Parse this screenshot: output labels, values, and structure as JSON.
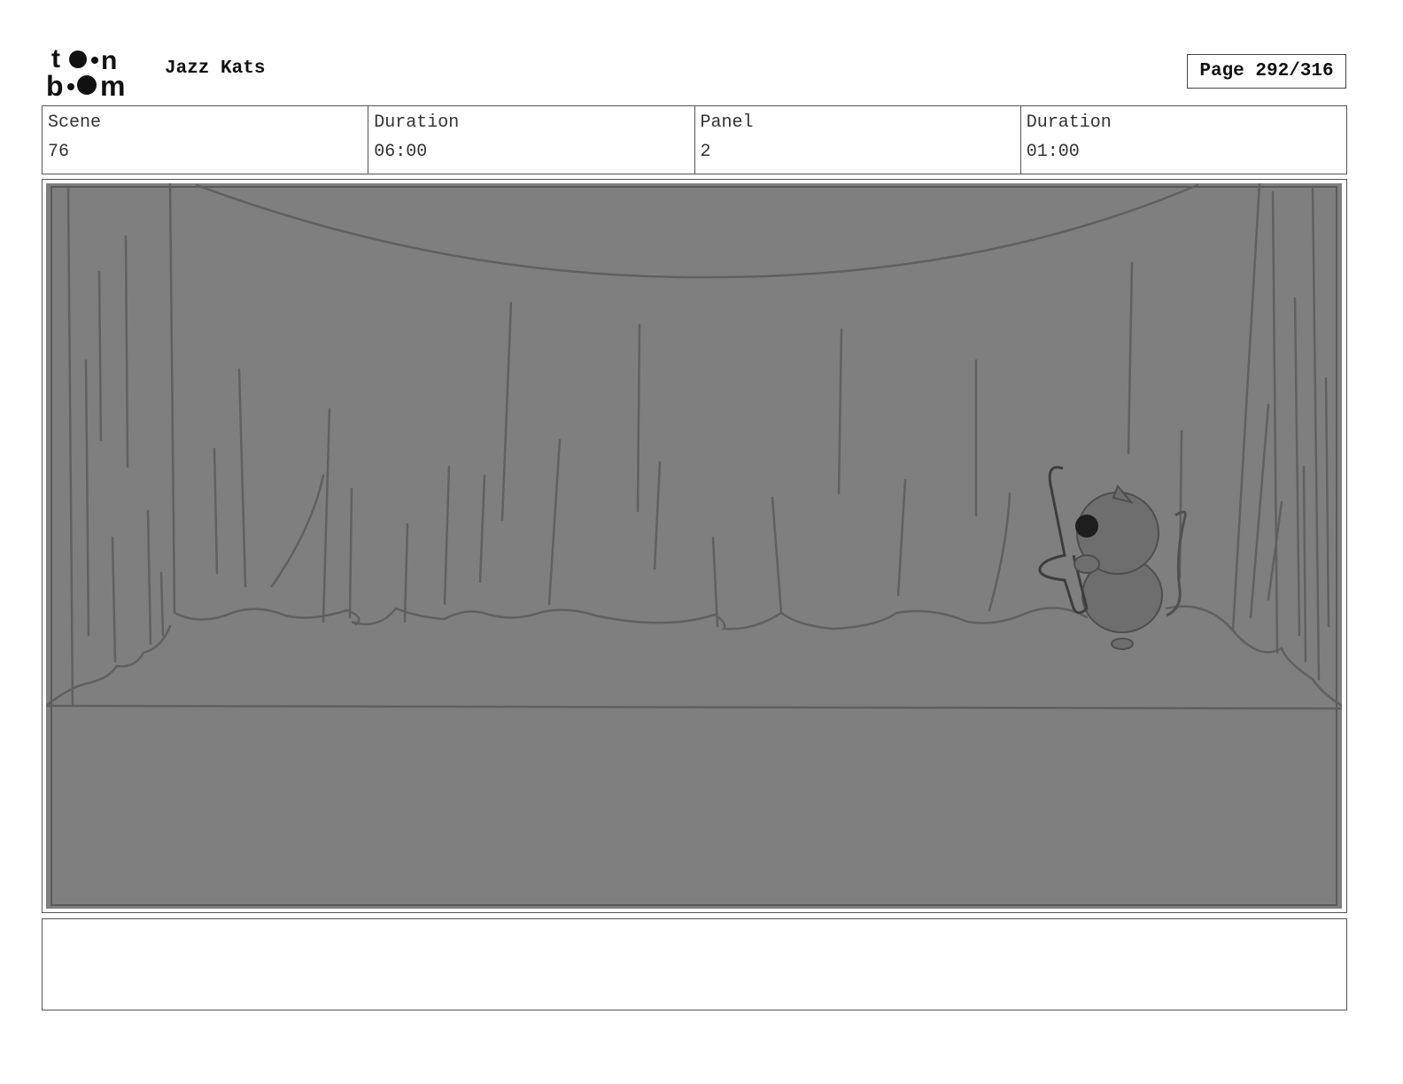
{
  "header": {
    "logo_text_top": "toon",
    "logo_text_bottom": "boom",
    "project_title": "Jazz Kats",
    "page_label": "Page 292/316"
  },
  "info": {
    "scene_label": "Scene",
    "scene_value": "76",
    "scene_duration_label": "Duration",
    "scene_duration_value": "06:00",
    "panel_label": "Panel",
    "panel_value": "2",
    "panel_duration_label": "Duration",
    "panel_duration_value": "01:00"
  },
  "panel": {
    "description": "",
    "background_color": "#7f7f7f",
    "line_color": "#5e5e5e"
  },
  "notes": {
    "text": ""
  }
}
